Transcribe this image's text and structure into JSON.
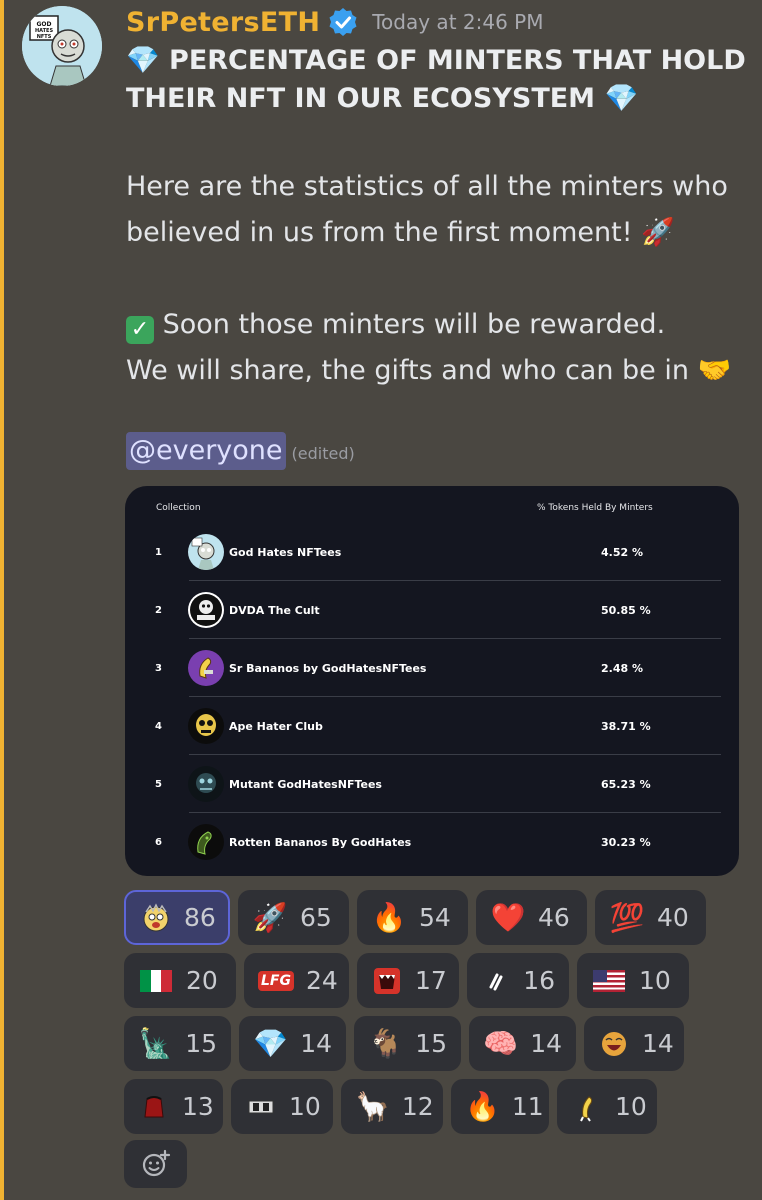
{
  "message": {
    "author": "SrPetersETH",
    "timestamp": "Today at 2:46 PM",
    "title": "PERCENTAGE OF MINTERS THAT HOLD THEIR NFT IN OUR ECOSYSTEM",
    "paragraph1_line1": "Here are the statistics of all the minters who",
    "paragraph1_line2": "believed in us from the first moment!",
    "paragraph2_line1": "Soon those minters will be rewarded.",
    "paragraph2_line2": "We will share, the gifts and who can be in",
    "mention": "@everyone",
    "edited": "(edited)",
    "avatar_text": "GOD HATES NFTS"
  },
  "table": {
    "header_collection": "Collection",
    "header_pct": "% Tokens Held By Minters",
    "rows": [
      {
        "rank": "1",
        "name": "God Hates NFTees",
        "pct": "4.52 %"
      },
      {
        "rank": "2",
        "name": "DVDA The Cult",
        "pct": "50.85 %"
      },
      {
        "rank": "3",
        "name": "Sr Bananos by GodHatesNFTees",
        "pct": "2.48 %"
      },
      {
        "rank": "4",
        "name": "Ape Hater Club",
        "pct": "38.71 %"
      },
      {
        "rank": "5",
        "name": "Mutant GodHatesNFTees",
        "pct": "65.23 %"
      },
      {
        "rank": "6",
        "name": "Rotten Bananos By GodHates",
        "pct": "30.23 %"
      }
    ]
  },
  "reactions": [
    {
      "emoji": "face-icon",
      "count": "86"
    },
    {
      "emoji": "🚀",
      "count": "65"
    },
    {
      "emoji": "🔥",
      "count": "54"
    },
    {
      "emoji": "❤️",
      "count": "46"
    },
    {
      "emoji": "💯",
      "count": "40"
    },
    {
      "emoji": "🇮🇹",
      "count": "20"
    },
    {
      "emoji": "LFG",
      "count": "24"
    },
    {
      "emoji": "mouth-icon",
      "count": "17"
    },
    {
      "emoji": "bolt-icon",
      "count": "16"
    },
    {
      "emoji": "🇺🇸",
      "count": "10"
    },
    {
      "emoji": "🗽",
      "count": "15"
    },
    {
      "emoji": "💎",
      "count": "14"
    },
    {
      "emoji": "🐐",
      "count": "15"
    },
    {
      "emoji": "🧠",
      "count": "14"
    },
    {
      "emoji": "laugh-icon",
      "count": "14"
    },
    {
      "emoji": "hat-icon",
      "count": "13"
    },
    {
      "emoji": "camera-icon",
      "count": "10"
    },
    {
      "emoji": "🦙",
      "count": "12"
    },
    {
      "emoji": "🔥",
      "count": "11"
    },
    {
      "emoji": "banana-icon",
      "count": "10"
    }
  ],
  "colors": {
    "background": "#4a4741",
    "username": "#f0b232",
    "card": "#141620",
    "reaction_bg": "#2f3035",
    "reaction_active_border": "#5d65d8"
  }
}
